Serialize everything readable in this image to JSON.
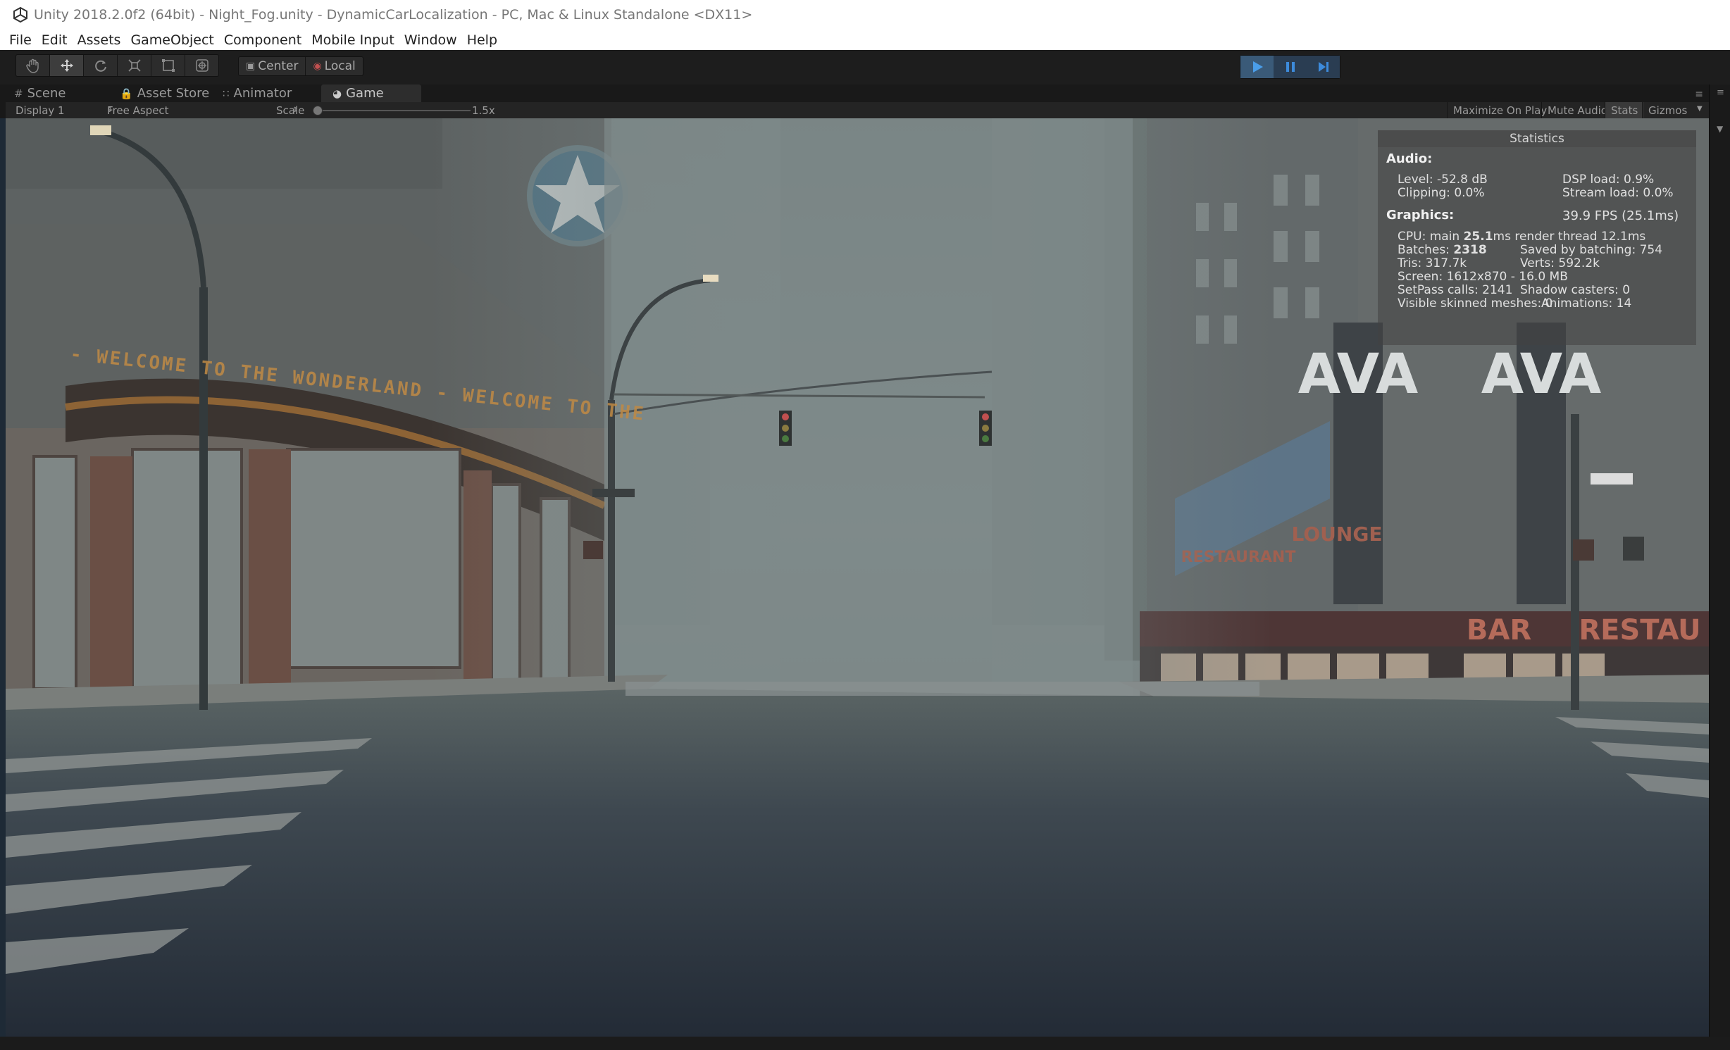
{
  "window": {
    "title": "Unity 2018.2.0f2 (64bit) - Night_Fog.unity - DynamicCarLocalization - PC, Mac & Linux Standalone <DX11>"
  },
  "menu": [
    "File",
    "Edit",
    "Assets",
    "GameObject",
    "Component",
    "Mobile Input",
    "Window",
    "Help"
  ],
  "toolbar": {
    "tools": [
      "hand-tool-icon",
      "move-tool-icon",
      "rotate-tool-icon",
      "scale-tool-icon",
      "rect-tool-icon",
      "transform-tool-icon"
    ],
    "pivot_label": "Center",
    "space_label": "Local",
    "play_controls": [
      "play-icon",
      "pause-icon",
      "step-icon"
    ]
  },
  "tabs": {
    "scene": "Scene",
    "asset_store": "Asset Store",
    "animator": "Animator",
    "game": "Game"
  },
  "game_options": {
    "display": "Display 1",
    "aspect": "Free Aspect",
    "scale_label": "Scale",
    "scale_value": "1.5x",
    "maximize": "Maximize On Play",
    "mute": "Mute Audio",
    "stats": "Stats",
    "gizmos": "Gizmos"
  },
  "statistics": {
    "header": "Statistics",
    "audio_label": "Audio:",
    "level": "Level: -52.8 dB",
    "dsp": "DSP load: 0.9%",
    "clipping": "Clipping: 0.0%",
    "stream": "Stream load: 0.0%",
    "graphics_label": "Graphics:",
    "fps": "39.9 FPS (25.1ms)",
    "cpu_prefix": "CPU: main ",
    "cpu_main": "25.1",
    "cpu_suffix": "ms  render thread 12.1ms",
    "batches_prefix": "Batches: ",
    "batches": "2318",
    "saved_batching": "Saved by batching: 754",
    "tris": "Tris: 317.7k",
    "verts": "Verts: 592.2k",
    "screen": "Screen: 1612x870 - 16.0 MB",
    "setpass": "SetPass calls: 2141",
    "shadow": "Shadow casters: 0",
    "skinned": "Visible skinned meshes: 0",
    "animations": "Animations: 14"
  },
  "scene_text": {
    "marquee": "- WELCOME TO THE WONDERLAND - WELCOME TO THE",
    "sign_ava_1": "AVA",
    "sign_ava_2": "AVA",
    "sign_bar": "BAR",
    "sign_restaurant": "RESTAU",
    "sign_lounge": "LOUNGE",
    "sign_restaurant2": "RESTAURANT"
  },
  "colors": {
    "play_accent": "#3d8bdb",
    "fog": "#7d8888",
    "road": "#2e3640"
  }
}
